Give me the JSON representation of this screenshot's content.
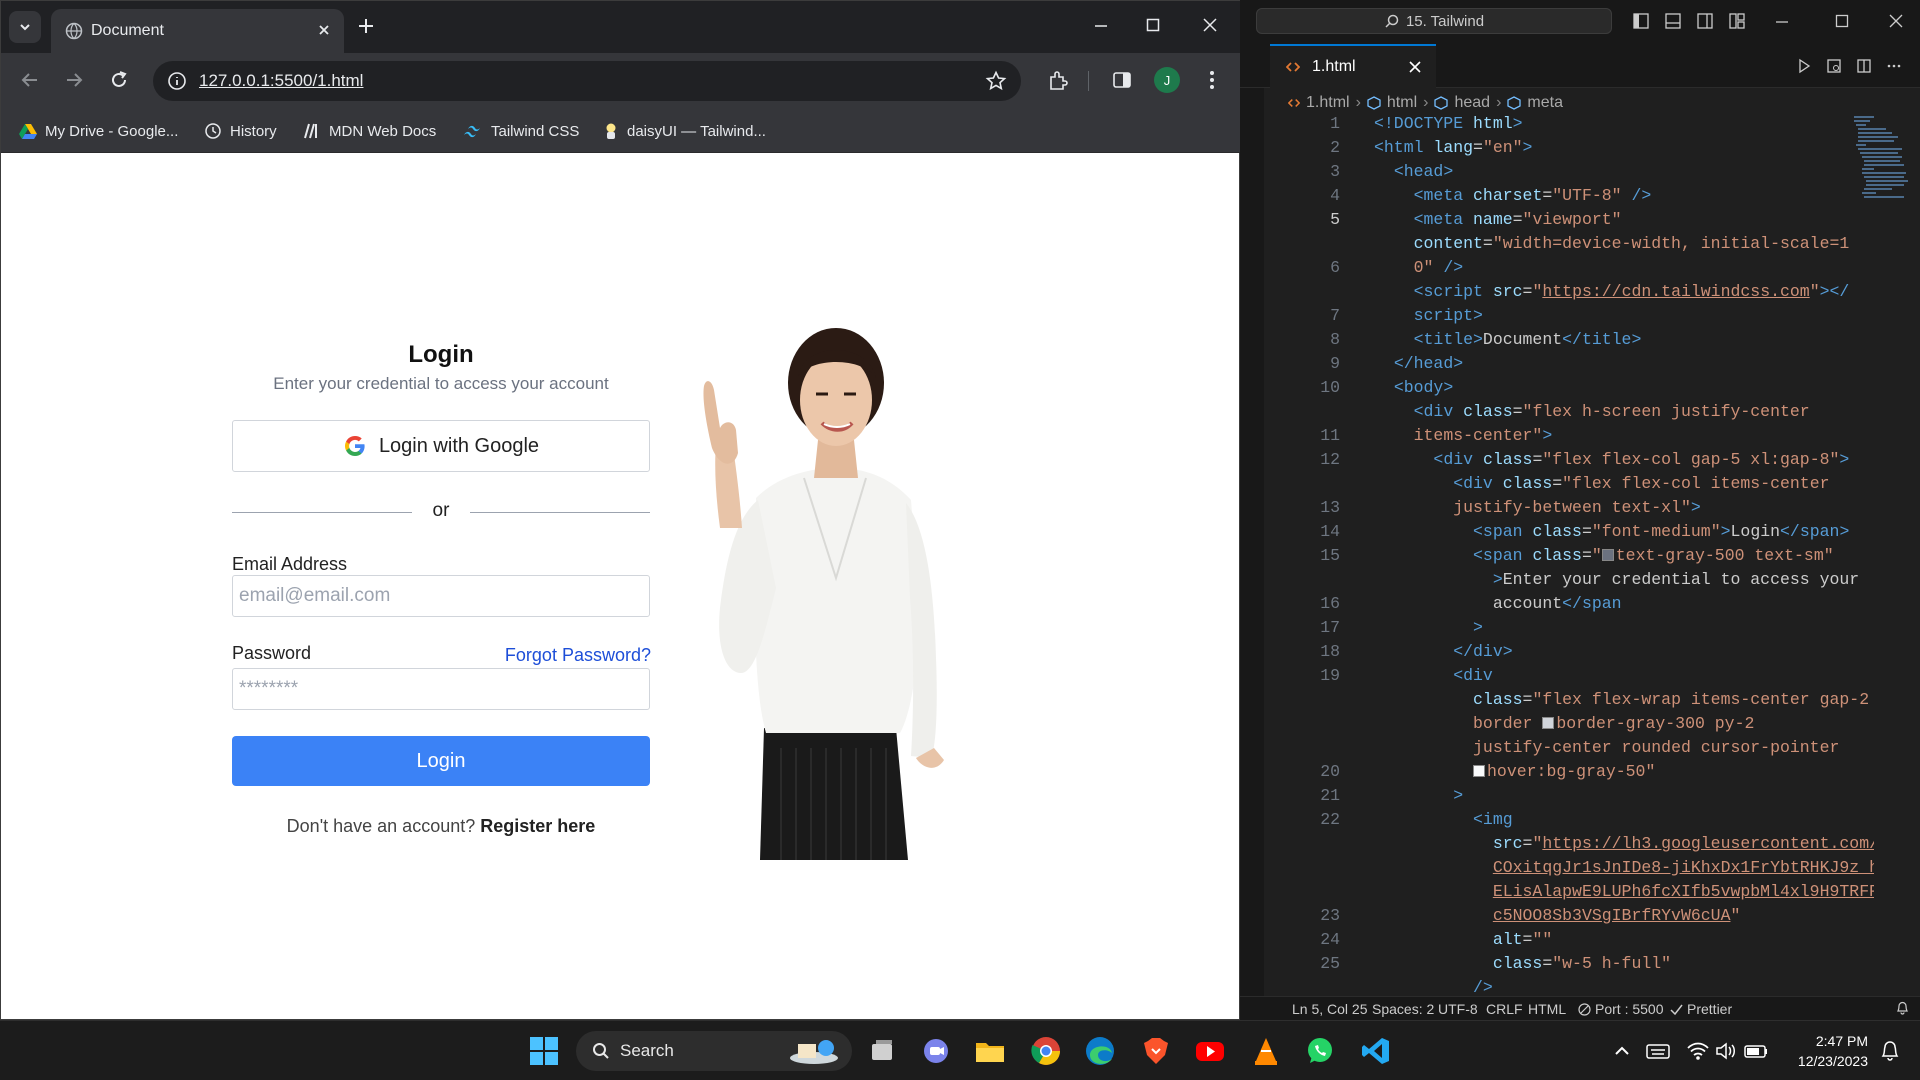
{
  "browser": {
    "tab_title": "Document",
    "url": "127.0.0.1:5500/1.html",
    "profile_initial": "J",
    "bookmarks": [
      {
        "label": "My Drive - Google...",
        "icon": "google-drive-icon"
      },
      {
        "label": "History",
        "icon": "history-icon"
      },
      {
        "label": "MDN Web Docs",
        "icon": "mdn-icon"
      },
      {
        "label": "Tailwind CSS",
        "icon": "tailwind-icon"
      },
      {
        "label": "daisyUI — Tailwind...",
        "icon": "daisyui-icon"
      }
    ]
  },
  "login": {
    "title": "Login",
    "subtitle": "Enter your credential to access your account",
    "google_button": "Login with Google",
    "divider": "or",
    "email_label": "Email Address",
    "email_placeholder": "email@email.com",
    "password_label": "Password",
    "password_placeholder": "********",
    "forgot": "Forgot Password?",
    "submit": "Login",
    "register_prefix": "Don't have an account?",
    "register_link": "Register here",
    "accent_color": "#3b82f6"
  },
  "vscode": {
    "command_center": "15. Tailwind",
    "tab": "1.html",
    "breadcrumb": [
      "1.html",
      "html",
      "head",
      "meta"
    ],
    "current_line": 5,
    "line_numbers": [
      "1",
      "2",
      "3",
      "4",
      "5",
      "",
      "6",
      "",
      "7",
      "8",
      "9",
      "10",
      "",
      "11",
      "12",
      "",
      "13",
      "14",
      "15",
      "",
      "16",
      "17",
      "18",
      "19",
      "",
      "",
      "",
      "20",
      "21",
      "22",
      "",
      "",
      "",
      "23",
      "24",
      "25"
    ],
    "status": {
      "position": "Ln 5, Col 25",
      "spaces": "Spaces: 2",
      "encoding": "UTF-8",
      "eol": "CRLF",
      "language": "HTML",
      "port": "Port : 5500",
      "formatter": "Prettier"
    }
  },
  "taskbar": {
    "search": "Search",
    "time": "2:47 PM",
    "date": "12/23/2023"
  }
}
